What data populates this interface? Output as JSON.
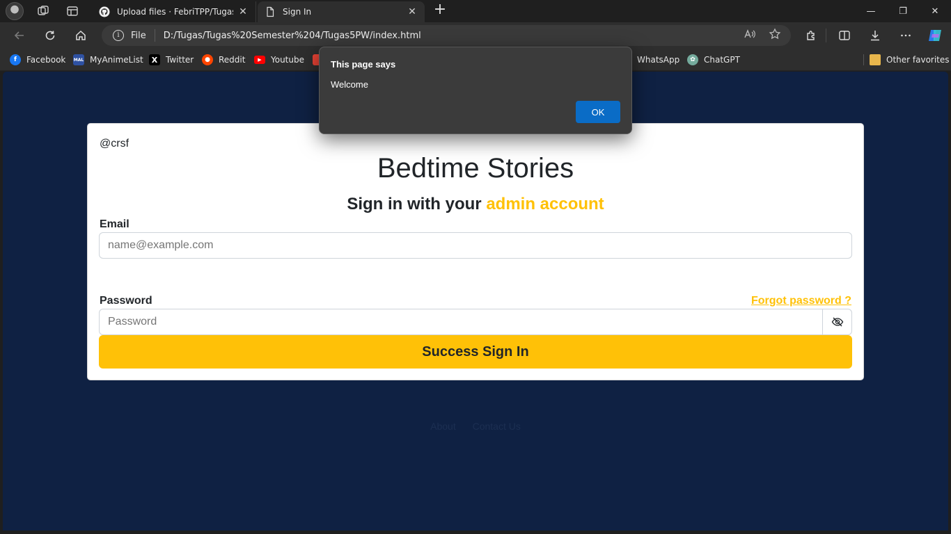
{
  "browser": {
    "tabs": [
      {
        "title": "Upload files · FebriTPP/Tugas-3-P",
        "close": "✕"
      },
      {
        "title": "Sign In",
        "close": "✕"
      }
    ],
    "new_tab": "+",
    "address": {
      "scheme_label": "File",
      "url": "D:/Tugas/Tugas%20Semester%204/Tugas5PW/index.html"
    },
    "window_controls": {
      "minimize": "—",
      "maximize": "❐",
      "close": "✕"
    }
  },
  "favorites": {
    "items": [
      {
        "label": "Facebook",
        "icon": "facebook-icon",
        "color": "#1877f2"
      },
      {
        "label": "MyAnimeList",
        "icon": "myanimelist-icon",
        "color": "#2e51a2"
      },
      {
        "label": "Twitter",
        "icon": "x-icon",
        "color": "#000000"
      },
      {
        "label": "Reddit",
        "icon": "reddit-icon",
        "color": "#ff4500"
      },
      {
        "label": "Youtube",
        "icon": "youtube-icon",
        "color": "#ff0000"
      },
      {
        "label": "WhatsApp",
        "icon": "whatsapp-icon",
        "color": "#25d366"
      },
      {
        "label": "ChatGPT",
        "icon": "chatgpt-icon",
        "color": "#74aa9c"
      }
    ],
    "other": "Other favorites"
  },
  "page": {
    "csrf": "@crsf",
    "title": "Bedtime Stories",
    "subtitle_prefix": "Sign in with your ",
    "subtitle_accent": "admin account",
    "email_label": "Email",
    "email_placeholder": "name@example.com",
    "password_label": "Password",
    "forgot": "Forgot password ?",
    "password_placeholder": "Password",
    "submit": "Success Sign In",
    "footer": [
      "About",
      "Contact Us"
    ],
    "colors": {
      "background": "#0f2143",
      "accent": "#ffc107"
    }
  },
  "dialog": {
    "title": "This page says",
    "message": "Welcome",
    "ok": "OK"
  }
}
